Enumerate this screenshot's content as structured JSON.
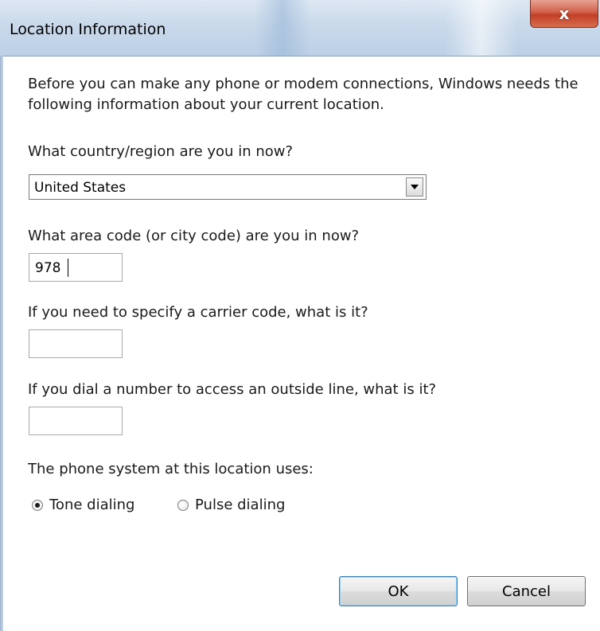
{
  "window": {
    "title": "Location Information",
    "close_glyph": "x"
  },
  "dialog": {
    "intro_text": "Before you can make any phone or modem connections, Windows needs the following information about your current location.",
    "country_label": "What country/region are you in now?",
    "country_value": "United States",
    "area_code_label": "What area code (or city code) are you in now?",
    "area_code_value": "978",
    "carrier_code_label": "If you need to specify a carrier code, what is it?",
    "carrier_code_value": "",
    "outside_line_label": "If you dial a number to access an outside line, what is it?",
    "outside_line_value": "",
    "phone_system_label": "The phone system at this location uses:",
    "dialing_options": [
      {
        "label": "Tone dialing",
        "selected": true
      },
      {
        "label": "Pulse dialing",
        "selected": false
      }
    ]
  },
  "buttons": {
    "ok": "OK",
    "cancel": "Cancel"
  },
  "icons": {
    "close": "close-icon",
    "dropdown": "chevron-down-icon"
  },
  "colors": {
    "close_button": "#c94a31",
    "default_button_border": "#3c7fb1"
  }
}
